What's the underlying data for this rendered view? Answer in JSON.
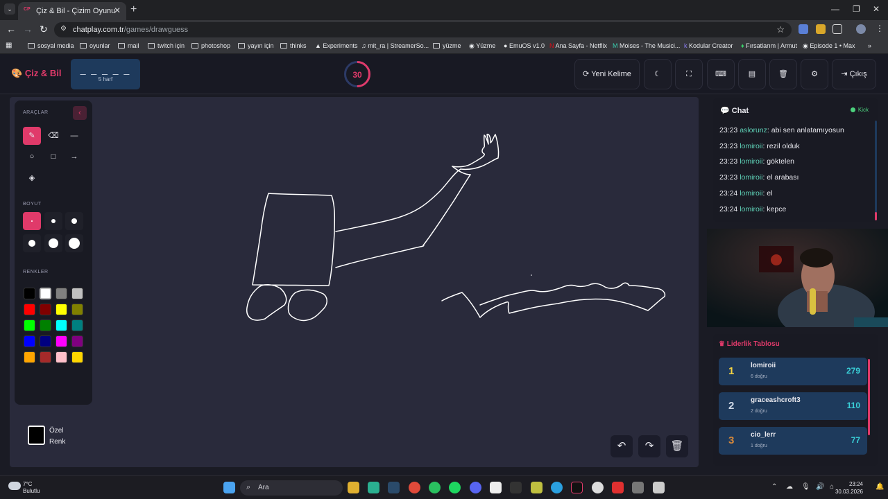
{
  "browser": {
    "tab_title": "Çiz & Bil - Çizim Oyunu",
    "favicon_text": "CP",
    "url_domain": "chatplay.com.tr",
    "url_path": "/games/drawguess",
    "bookmarks": [
      "sosyal media",
      "oyunlar",
      "mail",
      "twitch için",
      "photoshop",
      "yayın için",
      "thinks",
      "Experiments",
      "mit_ra | StreamerSo...",
      "yüzme",
      "Yüzme",
      "EmuOS v1.0",
      "Ana Sayfa - Netflix",
      "Moises - The Musici...",
      "Kodular Creator",
      "Fırsatlarım | Armut",
      "Episode 1 • Max"
    ]
  },
  "header": {
    "logo": "Çiz & Bil",
    "word_blanks": "_ _ _ _ _",
    "word_hint": "5 harf",
    "timer": "30",
    "timer_fraction": 0.5,
    "buttons": {
      "new_word": "Yeni Kelime",
      "exit": "Çıkış"
    }
  },
  "tools": {
    "tools_label": "ARAÇLAR",
    "size_label": "BOYUT",
    "colors_label": "RENKLER",
    "colors": [
      "#000000",
      "#ffffff",
      "#808080",
      "#c0c0c0",
      "#ff0000",
      "#800000",
      "#ffff00",
      "#808000",
      "#00ff00",
      "#008000",
      "#00ffff",
      "#008080",
      "#0000ff",
      "#000080",
      "#ff00ff",
      "#800080",
      "#ffa500",
      "#a52a2a",
      "#ffc0cb",
      "#ffd700"
    ],
    "custom_color_label": "Özel Renk"
  },
  "chat": {
    "title": "Chat",
    "platform": "Kick",
    "messages": [
      {
        "time": "23:23",
        "user": "aslorunz",
        "text": ": abi sen anlatamıyosun"
      },
      {
        "time": "23:23",
        "user": "lomiroii",
        "text": ": rezil olduk"
      },
      {
        "time": "23:23",
        "user": "lomiroii",
        "text": ": göktelen"
      },
      {
        "time": "23:23",
        "user": "lomiroii",
        "text": ": el arabası"
      },
      {
        "time": "23:24",
        "user": "lomiroii",
        "text": ": el"
      },
      {
        "time": "23:24",
        "user": "lomiroii",
        "text": ": kepce"
      }
    ]
  },
  "leaderboard": {
    "title": "Liderlik Tablosu",
    "rows": [
      {
        "rank": "1",
        "name": "lomiroii",
        "sub": "6 doğru",
        "score": "279",
        "rank_color": "#f5d442"
      },
      {
        "rank": "2",
        "name": "graceashcroft3",
        "sub": "2 doğru",
        "score": "110",
        "rank_color": "#cfd8e6"
      },
      {
        "rank": "3",
        "name": "cio_lerr",
        "sub": "1 doğru",
        "score": "77",
        "rank_color": "#d98a3a"
      }
    ]
  },
  "taskbar": {
    "weather_temp": "7°C",
    "weather_desc": "Bulutlu",
    "search_label": "Ara",
    "time": "23:24",
    "date": "30.03.2026"
  }
}
